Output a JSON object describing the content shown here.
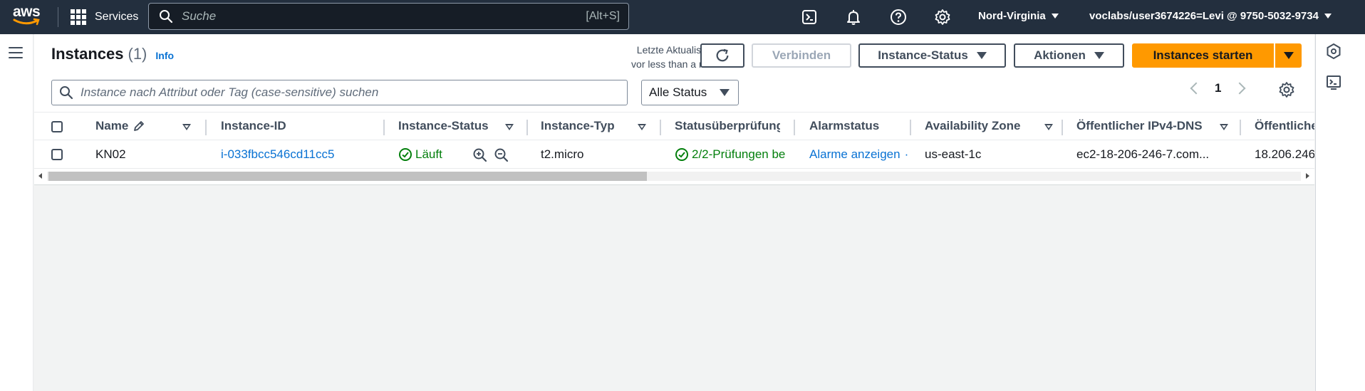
{
  "topnav": {
    "logo_text": "aws",
    "services_label": "Services",
    "search_placeholder": "Suche",
    "search_shortcut": "[Alt+S]",
    "region": "Nord-Virginia",
    "account": "voclabs/user3674226=Levi @ 9750-5032-9734",
    "icons": [
      "cloudshell-icon",
      "bell-icon",
      "help-icon",
      "gear-icon"
    ]
  },
  "header": {
    "title": "Instances",
    "count": "(1)",
    "info": "Info",
    "last_update_label": "Letzte Aktualisierung",
    "last_update_value": "vor less than a minute"
  },
  "actions": {
    "connect": "Verbinden",
    "instance_state": "Instance-Status",
    "actions": "Aktionen",
    "launch": "Instances starten"
  },
  "filter": {
    "placeholder": "Instance nach Attribut oder Tag (case-sensitive) suchen",
    "status_select": "Alle Status"
  },
  "pagination": {
    "current_page": "1"
  },
  "table": {
    "columns": {
      "name": "Name",
      "instance_id": "Instance-ID",
      "instance_status": "Instance-Status",
      "instance_type": "Instance-Typ",
      "status_check": "Statusüberprüfung",
      "alarm_status": "Alarmstatus",
      "availability_zone": "Availability Zone",
      "public_dns": "Öffentlicher IPv4-DNS",
      "public_ip": "Öffentliche"
    },
    "rows": [
      {
        "name": "KN02",
        "instance_id": "i-033fbcc546cd11cc5",
        "instance_status": "Läuft",
        "instance_type": "t2.micro",
        "status_check": "2/2-Prüfungen be",
        "alarm_status": "Alarme anzeigen",
        "availability_zone": "us-east-1c",
        "public_dns": "ec2-18-206-246-7.com...",
        "public_ip": "18.206.246"
      }
    ]
  },
  "colors": {
    "nav_bg": "#232f3e",
    "primary_orange": "#ff9900",
    "link_blue": "#0972d3",
    "success_green": "#037f0c"
  }
}
